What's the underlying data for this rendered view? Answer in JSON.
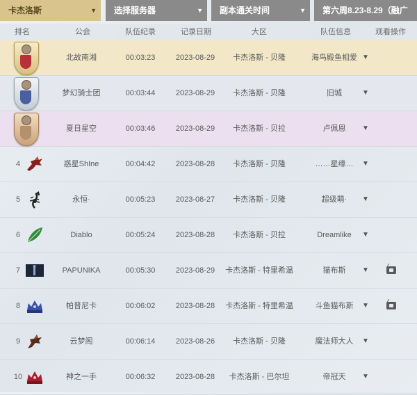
{
  "filters": {
    "region": "卡杰洛斯",
    "server": "选择服务器",
    "sort": "副本通关时间",
    "week": "第六周8.23-8.29（融广"
  },
  "columns": {
    "rank": "排名",
    "guild": "公会",
    "record": "队伍纪录",
    "date": "记录日期",
    "region": "大区",
    "info": "队伍信息",
    "watch": "观看操作"
  },
  "rows": [
    {
      "rank": "",
      "medal": "gold",
      "guild": "北故南湘",
      "time": "00:03:23",
      "date": "2023-08-29",
      "region": "卡杰洛斯 - 贝隆",
      "info": "海鸟殿鱼相爱",
      "watch": false
    },
    {
      "rank": "",
      "medal": "silver",
      "guild": "梦幻骑士团",
      "time": "00:03:44",
      "date": "2023-08-29",
      "region": "卡杰洛斯 - 贝隆",
      "info": "旧城",
      "watch": false
    },
    {
      "rank": "",
      "medal": "bronze",
      "guild": "夏日星空",
      "time": "00:03:46",
      "date": "2023-08-29",
      "region": "卡杰洛斯 - 贝拉",
      "info": "卢佩恩",
      "watch": false
    },
    {
      "rank": "4",
      "icon": "dragon-red-icon",
      "guild": "惑星ShIne",
      "time": "00:04:42",
      "date": "2023-08-28",
      "region": "卡杰洛斯 - 贝隆",
      "info": "……星缘…",
      "watch": false
    },
    {
      "rank": "5",
      "icon": "scorpion-icon",
      "guild": "永恒·",
      "time": "00:05:23",
      "date": "2023-08-27",
      "region": "卡杰洛斯 - 贝隆",
      "info": "超级萌·",
      "watch": false
    },
    {
      "rank": "6",
      "icon": "green-leaf-icon",
      "guild": "Diablo",
      "time": "00:05:24",
      "date": "2023-08-28",
      "region": "卡杰洛斯 - 贝拉",
      "info": "Dreamlike",
      "watch": false
    },
    {
      "rank": "7",
      "icon": "dark-banner-icon",
      "guild": "PAPUNIKA",
      "time": "00:05:30",
      "date": "2023-08-29",
      "region": "卡杰洛斯 - 特里希温",
      "info": "猫布斯",
      "watch": true
    },
    {
      "rank": "8",
      "icon": "blue-crown-icon",
      "guild": "帕普尼卡",
      "time": "00:06:02",
      "date": "2023-08-28",
      "region": "卡杰洛斯 - 特里希温",
      "info": "斗鱼猫布斯",
      "watch": true
    },
    {
      "rank": "9",
      "icon": "dragon-brown-icon",
      "guild": "云梦阁",
      "time": "00:06:14",
      "date": "2023-08-26",
      "region": "卡杰洛斯 - 贝隆",
      "info": "魔法师大人",
      "watch": false
    },
    {
      "rank": "10",
      "icon": "red-crown-icon",
      "guild": "神之一手",
      "time": "00:06:32",
      "date": "2023-08-28",
      "region": "卡杰洛斯 - 巴尔坦",
      "info": "帝冠天",
      "watch": false
    }
  ],
  "caret": "▼",
  "dropdown_arrow": "▼"
}
